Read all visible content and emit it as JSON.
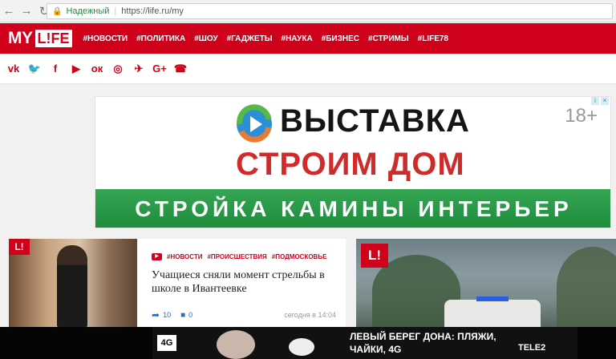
{
  "browser": {
    "secure_label": "Надежный",
    "url": "https://life.ru/my"
  },
  "header": {
    "logo_left": "MY",
    "logo_right": "L!FE",
    "menu": [
      "#НОВОСТИ",
      "#ПОЛИТИКА",
      "#ШОУ",
      "#ГАДЖЕТЫ",
      "#НАУКА",
      "#БИЗНЕС",
      "#СТРИМЫ",
      "#LIFE78"
    ]
  },
  "social": {
    "icons": [
      {
        "name": "vk-icon",
        "glyph": "vk"
      },
      {
        "name": "twitter-icon",
        "glyph": "🐦"
      },
      {
        "name": "facebook-icon",
        "glyph": "f"
      },
      {
        "name": "youtube-icon",
        "glyph": "▶"
      },
      {
        "name": "odnoklassniki-icon",
        "glyph": "ок"
      },
      {
        "name": "instagram-icon",
        "glyph": "◎"
      },
      {
        "name": "telegram-icon",
        "glyph": "✈"
      },
      {
        "name": "googleplus-icon",
        "glyph": "G+"
      },
      {
        "name": "viber-icon",
        "glyph": "☎"
      }
    ]
  },
  "ad_banner": {
    "title": "ВЫСТАВКА",
    "subtitle": "СТРОИМ ДОМ",
    "tagline": "СТРОЙКА  КАМИНЫ  ИНТЕРЬЕР",
    "age": "18+"
  },
  "article1": {
    "badge": "L!",
    "tags": [
      "#НОВОСТИ",
      "#ПРОИСШЕСТВИЯ",
      "#ПОДМОСКОВЬЕ"
    ],
    "headline": "Учащиеся сняли момент стрельбы в школе в Ивантеевке",
    "shares": "10",
    "comments": "0",
    "time": "сегодня в 14:04"
  },
  "article2": {
    "badge": "L!"
  },
  "bottom_ad": {
    "network": "4G",
    "headline": "ЛЕВЫЙ БЕРЕГ ДОНА: ПЛЯЖИ, ЧАЙКИ, 4G",
    "brand": "TELE2"
  }
}
